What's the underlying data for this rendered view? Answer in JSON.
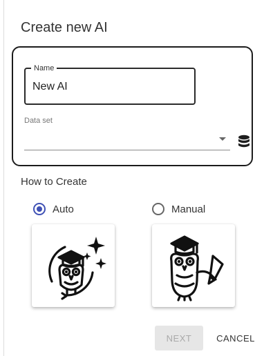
{
  "dialog": {
    "title": "Create new AI"
  },
  "form": {
    "name_label": "Name",
    "name_value": "New AI",
    "dataset_label": "Data set",
    "dataset_value": "",
    "dataset_icon": "database-icon"
  },
  "how_to_create": {
    "label": "How to Create",
    "options": [
      {
        "label": "Auto",
        "selected": true,
        "image": "owl-ai-sparkles-illustration"
      },
      {
        "label": "Manual",
        "selected": false,
        "image": "owl-writing-pencil-illustration"
      }
    ]
  },
  "actions": {
    "next_label": "NEXT",
    "cancel_label": "CANCEL"
  },
  "colors": {
    "accent": "#3f51b5",
    "disabled_bg": "#e6e6e6",
    "disabled_text": "#a9a9a9"
  }
}
